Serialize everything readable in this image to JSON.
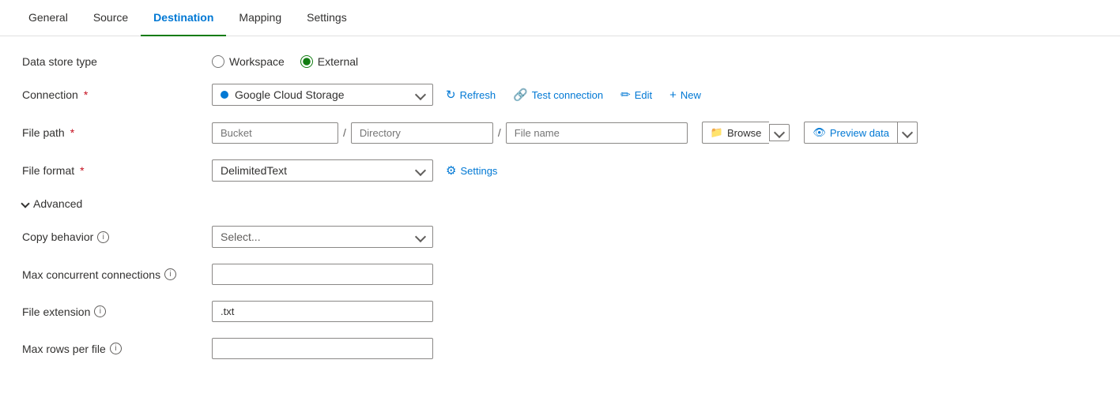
{
  "tabs": [
    {
      "id": "general",
      "label": "General",
      "active": false
    },
    {
      "id": "source",
      "label": "Source",
      "active": false
    },
    {
      "id": "destination",
      "label": "Destination",
      "active": true
    },
    {
      "id": "mapping",
      "label": "Mapping",
      "active": false
    },
    {
      "id": "settings",
      "label": "Settings",
      "active": false
    }
  ],
  "form": {
    "dataStoreType": {
      "label": "Data store type",
      "options": [
        "Workspace",
        "External"
      ],
      "selected": "External"
    },
    "connection": {
      "label": "Connection",
      "required": true,
      "value": "Google Cloud Storage",
      "refreshLabel": "Refresh",
      "testLabel": "Test connection",
      "editLabel": "Edit",
      "newLabel": "New"
    },
    "filePath": {
      "label": "File path",
      "required": true,
      "bucketPlaceholder": "Bucket",
      "directoryPlaceholder": "Directory",
      "filenamePlaceholder": "File name",
      "browseLabel": "Browse",
      "previewLabel": "Preview data"
    },
    "fileFormat": {
      "label": "File format",
      "required": true,
      "value": "DelimitedText",
      "settingsLabel": "Settings"
    },
    "advanced": {
      "label": "Advanced",
      "expanded": true
    },
    "copyBehavior": {
      "label": "Copy behavior",
      "placeholder": "Select...",
      "value": ""
    },
    "maxConcurrentConnections": {
      "label": "Max concurrent connections",
      "value": ""
    },
    "fileExtension": {
      "label": "File extension",
      "value": ".txt"
    },
    "maxRowsPerFile": {
      "label": "Max rows per file",
      "value": ""
    }
  },
  "icons": {
    "chevronDown": "▾",
    "refresh": "↻",
    "testConnection": "🔗",
    "edit": "✏",
    "new": "+",
    "browse": "📁",
    "preview": "👁",
    "settings": "⚙",
    "info": "i",
    "chevronSmall": "›"
  },
  "colors": {
    "accent": "#0078d4",
    "activeTab": "#107c10",
    "required": "#c50f1f"
  }
}
